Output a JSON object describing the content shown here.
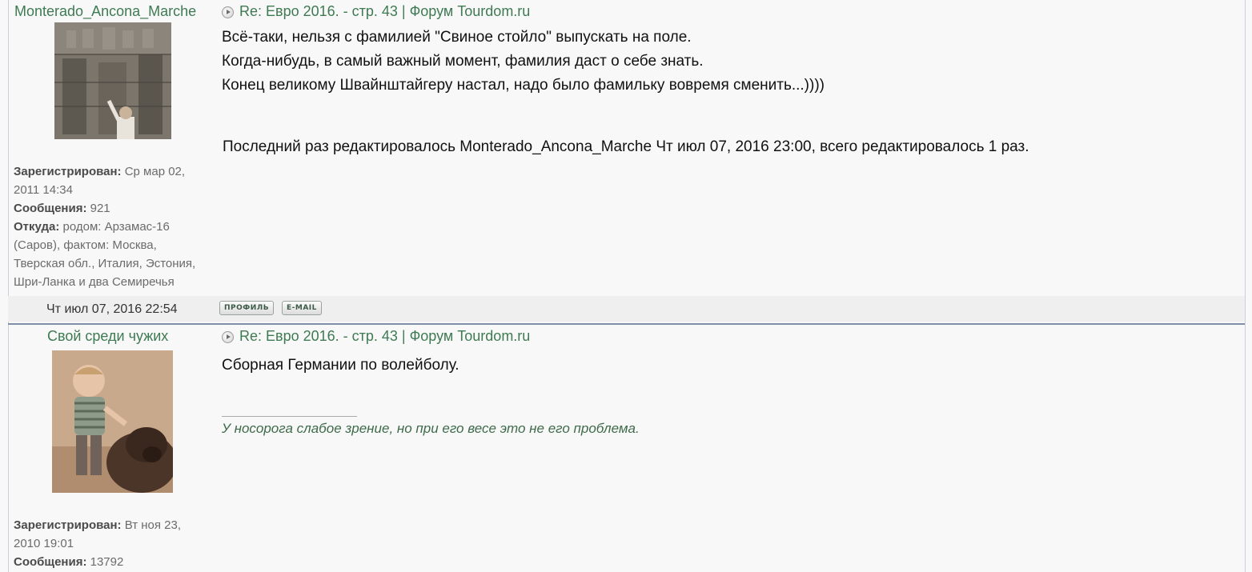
{
  "posts": [
    {
      "author": "Monterado_Ancona_Marche",
      "subject": "Re: Евро 2016. - стр. 43 | Форум Tourdom.ru",
      "body": [
        "Всё-таки, нельзя с фамилией \"Свиное стойло\" выпускать на поле.",
        "Когда-нибудь, в самый важный момент, фамилия даст о себе знать.",
        "Конец великому Швайнштайгеру настал, надо было фамильку вовремя сменить...))))"
      ],
      "edited_note": "Последний раз редактировалось Monterado_Ancona_Marche Чт июл 07, 2016 23:00, всего редактировалось 1 раз.",
      "registered_label": "Зарегистрирован:",
      "registered_line1": "Ср мар 02,",
      "registered_line2": "2011 14:34",
      "messages_label": "Сообщения:",
      "messages": "921",
      "from_label": "Откуда:",
      "from_line1": "родом: Арзамас-16",
      "from_line2": "(Саров), фактом: Москва,",
      "from_line3": "Тверская обл., Италия, Эстония,",
      "from_line4": "Шри-Ланка и два Семиречья",
      "date": "Чт июл 07, 2016 22:54",
      "profile_button": "ПРОФИЛЬ",
      "email_button": "E-MAIL"
    },
    {
      "author": "Свой среди чужих",
      "subject": "Re: Евро 2016. - стр. 43 | Форум Tourdom.ru",
      "body": [
        "Сборная Германии по волейболу."
      ],
      "signature": "У носорога слабое зрение, но при его весе это не его проблема.",
      "registered_label": "Зарегистрирован:",
      "registered_line1": "Вт ноя 23,",
      "registered_line2": "2010 19:01",
      "messages_label": "Сообщения:",
      "messages": "13792"
    }
  ],
  "icons": {
    "post_icon": "post-arrow-icon"
  },
  "colors": {
    "link": "#3e7a52",
    "separator": "#7f8fa8",
    "background": "#f8f8f8"
  }
}
